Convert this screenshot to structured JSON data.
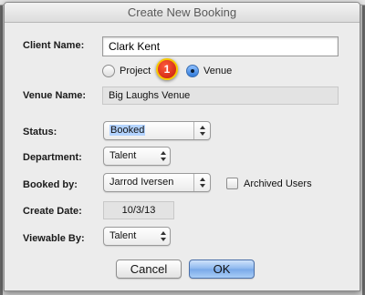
{
  "dialog": {
    "title": "Create New Booking"
  },
  "form": {
    "client_name": {
      "label": "Client Name:",
      "value": "Clark Kent"
    },
    "booking_type": {
      "options": [
        {
          "label": "Project",
          "selected": false
        },
        {
          "label": "Venue",
          "selected": true
        }
      ]
    },
    "callout": {
      "number": "1"
    },
    "venue_name": {
      "label": "Venue Name:",
      "value": "Big Laughs Venue"
    },
    "status": {
      "label": "Status:",
      "value": "Booked"
    },
    "department": {
      "label": "Department:",
      "value": "Talent"
    },
    "booked_by": {
      "label": "Booked by:",
      "value": "Jarrod Iversen"
    },
    "archived_users": {
      "label": "Archived Users",
      "checked": false
    },
    "create_date": {
      "label": "Create Date:",
      "value": "10/3/13"
    },
    "viewable_by": {
      "label": "Viewable By:",
      "value": "Talent"
    }
  },
  "buttons": {
    "cancel": "Cancel",
    "ok": "OK"
  },
  "colors": {
    "accent": "#3b82e4",
    "callout": "#d8230a"
  }
}
